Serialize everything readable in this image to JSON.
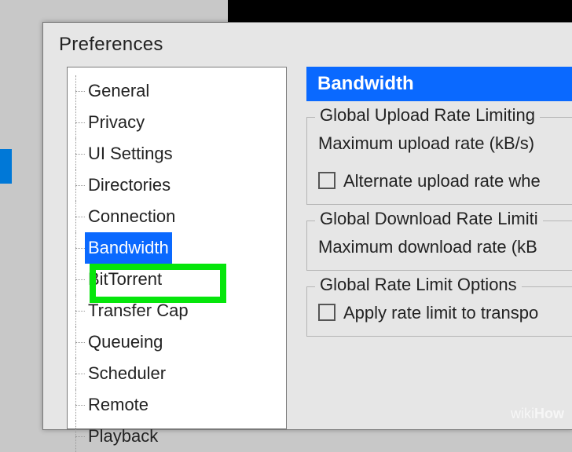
{
  "window": {
    "title": "Preferences"
  },
  "tree": {
    "items": [
      {
        "label": "General"
      },
      {
        "label": "Privacy"
      },
      {
        "label": "UI Settings"
      },
      {
        "label": "Directories"
      },
      {
        "label": "Connection"
      },
      {
        "label": "Bandwidth",
        "selected": true
      },
      {
        "label": "BitTorrent"
      },
      {
        "label": "Transfer Cap"
      },
      {
        "label": "Queueing"
      },
      {
        "label": "Scheduler"
      },
      {
        "label": "Remote"
      },
      {
        "label": "Playback"
      }
    ]
  },
  "panel": {
    "header": "Bandwidth",
    "upload": {
      "legend": "Global Upload Rate Limiting",
      "line1": "Maximum upload rate (kB/s)",
      "alt": "Alternate upload rate whe"
    },
    "download": {
      "legend": "Global Download Rate Limiti",
      "line1": "Maximum download rate (kB"
    },
    "global": {
      "legend": "Global Rate Limit Options",
      "line1": "Apply rate limit to transpo"
    }
  },
  "watermark": {
    "a": "wiki",
    "b": "How"
  }
}
